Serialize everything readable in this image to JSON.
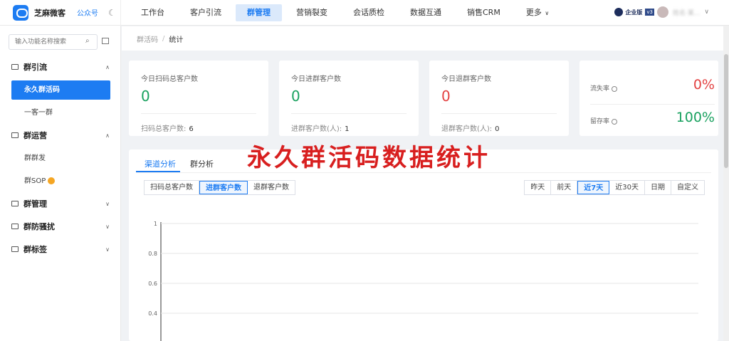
{
  "app": {
    "brand": "芝麻微客",
    "gzh": "公众号",
    "theme_icon": "moon-icon"
  },
  "nav": {
    "items": [
      "工作台",
      "客户引流",
      "群管理",
      "营销裂变",
      "会话质检",
      "数据互通",
      "销售CRM",
      "更多"
    ],
    "active": "群管理"
  },
  "account": {
    "edition": "企业版",
    "version": "v3",
    "user": "姓名·某..."
  },
  "sidebar": {
    "search_placeholder": "输入功能名称搜索",
    "groups": [
      {
        "label": "群引流",
        "items": [
          "永久群活码",
          "一客一群"
        ],
        "expanded": true
      },
      {
        "label": "群运营",
        "items": [
          "群群发",
          "群SOP"
        ],
        "expanded": true
      },
      {
        "label": "群管理",
        "items": [],
        "expanded": false
      },
      {
        "label": "群防骚扰",
        "items": [],
        "expanded": false
      },
      {
        "label": "群标签",
        "items": [],
        "expanded": false
      }
    ],
    "active_item": "永久群活码"
  },
  "breadcrumb": {
    "parent": "群活码",
    "separator": "/",
    "current": "统计"
  },
  "cards": [
    {
      "title": "今日扫码总客户数",
      "value": "0",
      "color": "#19a15f",
      "foot_label": "扫码总客户数:",
      "foot_value": "6"
    },
    {
      "title": "今日进群客户数",
      "value": "0",
      "color": "#19a15f",
      "foot_label": "进群客户数(人):",
      "foot_value": "1"
    },
    {
      "title": "今日退群客户数",
      "value": "0",
      "color": "#e34242",
      "foot_label": "退群客户数(人):",
      "foot_value": "0"
    }
  ],
  "rates": [
    {
      "label": "流失率",
      "value": "0%",
      "color": "#e34242"
    },
    {
      "label": "留存率",
      "value": "100%",
      "color": "#19a15f"
    }
  ],
  "panel": {
    "tabs": [
      "渠道分析",
      "群分析"
    ],
    "active_tab": "渠道分析",
    "overlay_text": "永久群活码数据统计",
    "metric_buttons": [
      "扫码总客户数",
      "进群客户数",
      "退群客户数"
    ],
    "active_metric": "进群客户数",
    "range_buttons": [
      "昨天",
      "前天",
      "近7天",
      "近30天",
      "日期",
      "自定义"
    ],
    "active_range": "近7天"
  },
  "chart_data": {
    "type": "line",
    "y_ticks": [
      "1",
      "0.8",
      "0.6",
      "0.4"
    ],
    "ylim": [
      0,
      1
    ],
    "grid": true,
    "series": []
  }
}
